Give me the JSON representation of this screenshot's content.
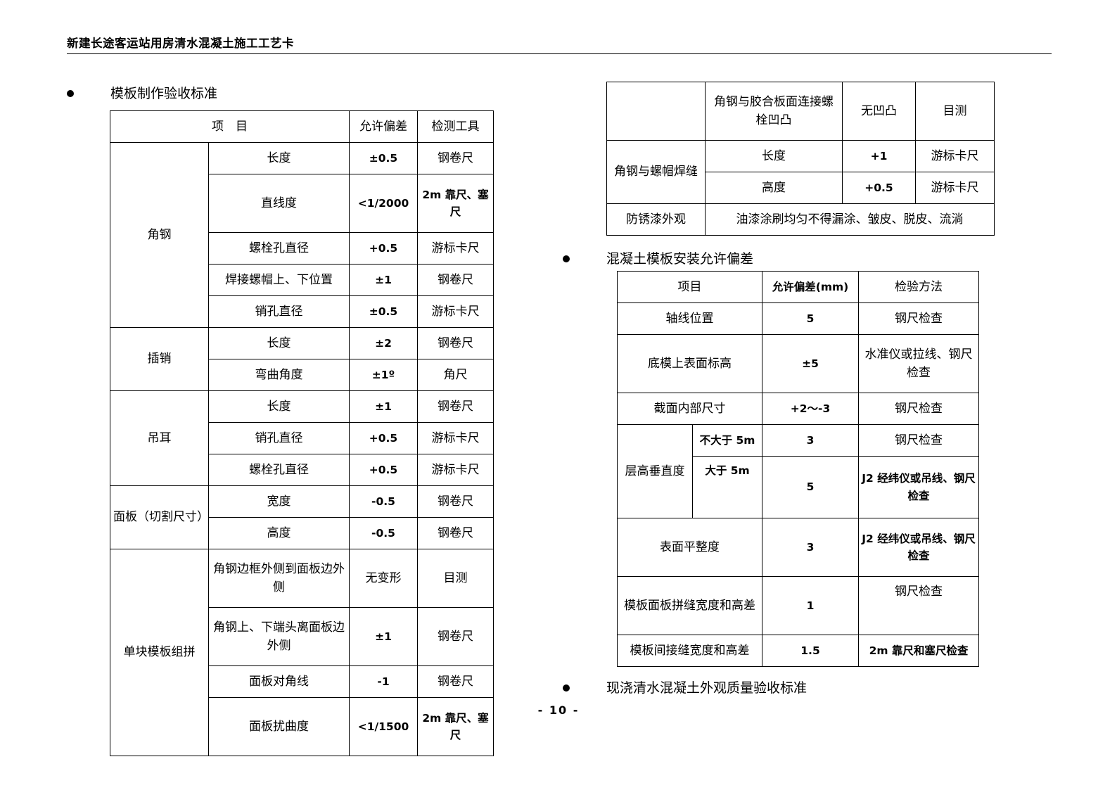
{
  "header": {
    "title": "新建长途客运站用房清水混凝土施工工艺卡"
  },
  "sections": {
    "formwork_fabrication": {
      "bullet_label": "模板制作验收标准"
    },
    "formwork_installation": {
      "bullet_label": "混凝土模板安装允许偏差"
    },
    "appearance_acceptance": {
      "bullet_label": "现浇清水混凝土外观质量验收标准"
    }
  },
  "table_formwork_fabrication": {
    "headers": {
      "item": "项　目",
      "tolerance": "允许偏差",
      "tool": "检测工具"
    },
    "groups": [
      {
        "name": "角钢",
        "rows": [
          {
            "item": "长度",
            "tolerance": "±0.5",
            "tool": "钢卷尺"
          },
          {
            "item": "直线度",
            "tolerance": "<1/2000",
            "tool": "2m 靠尺、塞尺"
          },
          {
            "item": "螺栓孔直径",
            "tolerance": "+0.5",
            "tool": "游标卡尺"
          },
          {
            "item": "焊接螺帽上、下位置",
            "tolerance": "±1",
            "tool": "钢卷尺"
          },
          {
            "item": "销孔直径",
            "tolerance": "±0.5",
            "tool": "游标卡尺"
          }
        ]
      },
      {
        "name": "插销",
        "rows": [
          {
            "item": "长度",
            "tolerance": "±2",
            "tool": "钢卷尺"
          },
          {
            "item": "弯曲角度",
            "tolerance": "±1º",
            "tool": "角尺"
          }
        ]
      },
      {
        "name": "吊耳",
        "rows": [
          {
            "item": "长度",
            "tolerance": "±1",
            "tool": "钢卷尺"
          },
          {
            "item": "销孔直径",
            "tolerance": "+0.5",
            "tool": "游标卡尺"
          },
          {
            "item": "螺栓孔直径",
            "tolerance": "+0.5",
            "tool": "游标卡尺"
          }
        ]
      },
      {
        "name": "面板（切割尺寸）",
        "rows": [
          {
            "item": "宽度",
            "tolerance": "-0.5",
            "tool": "钢卷尺"
          },
          {
            "item": "高度",
            "tolerance": "-0.5",
            "tool": "钢卷尺"
          }
        ]
      },
      {
        "name": "单块模板组拼",
        "rows": [
          {
            "item": "角钢边框外侧到面板边外侧",
            "tolerance": "无变形",
            "tool": "目测"
          },
          {
            "item": "角钢上、下端头离面板边外侧",
            "tolerance": "±1",
            "tool": "钢卷尺"
          },
          {
            "item": "面板对角线",
            "tolerance": "-1",
            "tool": "钢卷尺"
          },
          {
            "item": "面板扰曲度",
            "tolerance": "<1/1500",
            "tool": "2m 靠尺、塞尺"
          }
        ]
      }
    ]
  },
  "table_formwork_fabrication_continued": {
    "groups": [
      {
        "name": "",
        "rows": [
          {
            "item": "角钢与胶合板面连接螺栓凹凸",
            "tolerance": "无凹凸",
            "tool": "目测"
          }
        ]
      },
      {
        "name": "角钢与螺帽焊缝",
        "rows": [
          {
            "item": "长度",
            "tolerance": "+1",
            "tool": "游标卡尺"
          },
          {
            "item": "高度",
            "tolerance": "+0.5",
            "tool": "游标卡尺"
          }
        ]
      }
    ],
    "last_row": {
      "name": "防锈漆外观",
      "value": "油漆涂刷均匀不得漏涂、皱皮、脱皮、流淌"
    }
  },
  "table_installation_tolerance": {
    "headers": {
      "item": "项目",
      "tolerance": "允许偏差(mm)",
      "method": "检验方法"
    },
    "rows": [
      {
        "item": "轴线位置",
        "tolerance": "5",
        "method": "钢尺检查"
      },
      {
        "item": "底模上表面标高",
        "tolerance": "±5",
        "method": "水准仪或拉线、钢尺检查"
      },
      {
        "item": "截面内部尺寸",
        "tolerance": "+2～-3",
        "method": "钢尺检查"
      }
    ],
    "story_height_group": {
      "name": "层高垂直度",
      "rows": [
        {
          "item": "不大于 5m",
          "tolerance": "3",
          "method": "钢尺检查"
        },
        {
          "item": "大于 5m",
          "tolerance": "5",
          "method": "J2 经纬仪或吊线、钢尺检查"
        }
      ]
    },
    "rows_after": [
      {
        "item": "表面平整度",
        "tolerance": "3",
        "method": "J2 经纬仪或吊线、钢尺检查"
      },
      {
        "item": "模板面板拼缝宽度和高差",
        "tolerance": "1",
        "method": "钢尺检查"
      },
      {
        "item": "模板间接缝宽度和高差",
        "tolerance": "1.5",
        "method": "2m 靠尺和塞尺检查"
      }
    ]
  },
  "footer": {
    "page_number": "-  10  -"
  }
}
